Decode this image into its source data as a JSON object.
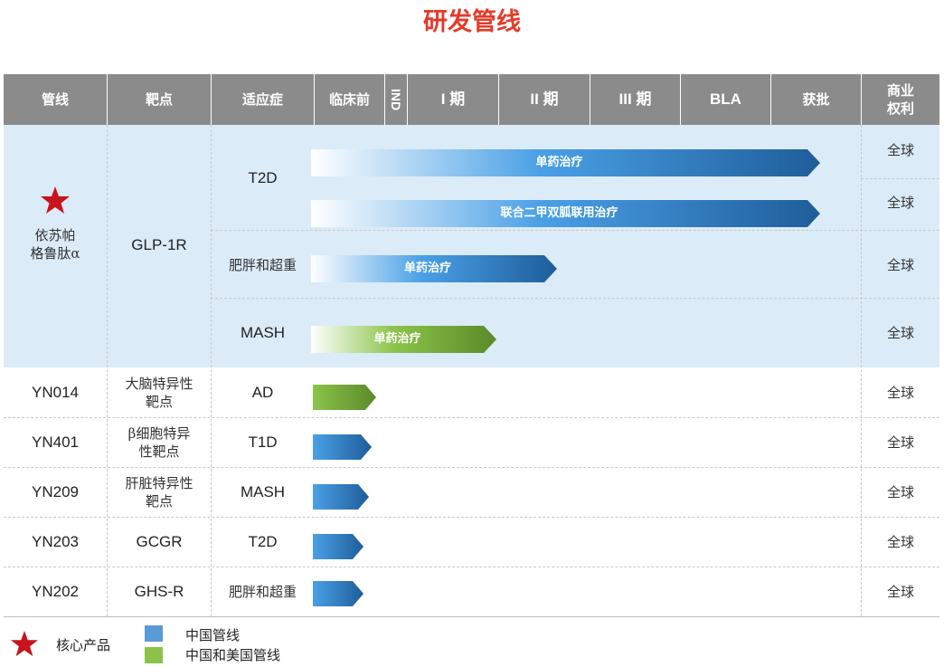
{
  "title": "研发管线",
  "headers": {
    "pipeline": "管线",
    "target": "靶点",
    "indication": "适应症",
    "preclinical": "临床前",
    "ind": "IND",
    "phase1": "I 期",
    "phase2": "II 期",
    "phase3": "III 期",
    "bla": "BLA",
    "approved": "获批",
    "rights": "商业\n权利"
  },
  "core_product": {
    "name": "依苏帕\n格鲁肽α",
    "target": "GLP-1R",
    "indications": [
      "T2D",
      "肥胖和超重",
      "MASH"
    ],
    "bars": [
      {
        "label": "单药治疗",
        "stage_fraction": 0.92,
        "color": "blue",
        "rights": "全球"
      },
      {
        "label": "联合二甲双胍联用治疗",
        "stage_fraction": 0.92,
        "color": "blue",
        "rights": "全球"
      },
      {
        "label": "单药治疗",
        "stage_fraction": 0.44,
        "color": "blue",
        "rights": "全球"
      },
      {
        "label": "单药治疗",
        "stage_fraction": 0.33,
        "color": "green",
        "rights": "全球"
      }
    ]
  },
  "rows": [
    {
      "name": "YN014",
      "target": "大脑特异性\n靶点",
      "indication": "AD",
      "color": "green",
      "rights": "全球"
    },
    {
      "name": "YN401",
      "target": "β细胞特异\n性靶点",
      "indication": "T1D",
      "color": "blue",
      "rights": "全球"
    },
    {
      "name": "YN209",
      "target": "肝脏特异性\n靶点",
      "indication": "MASH",
      "color": "blue",
      "rights": "全球"
    },
    {
      "name": "YN203",
      "target": "GCGR",
      "indication": "T2D",
      "color": "blue",
      "rights": "全球"
    },
    {
      "name": "YN202",
      "target": "GHS-R",
      "indication": "肥胖和超重",
      "color": "blue",
      "rights": "全球"
    }
  ],
  "legend": {
    "core": "核心产品",
    "china": "中国管线",
    "china_us": "中国和美国管线"
  },
  "colors": {
    "title": "#e53a2a",
    "header_bg": "#8b8b8b",
    "core_bg": "#dcebf8",
    "star": "#c8141c",
    "blue_dark": "#1e5d9a",
    "blue_light": "#4aa0e6",
    "green_dark": "#5b8a2a",
    "green_light": "#8bc34a",
    "legend_blue": "#5b9bd5",
    "legend_green": "#8bc34a"
  }
}
